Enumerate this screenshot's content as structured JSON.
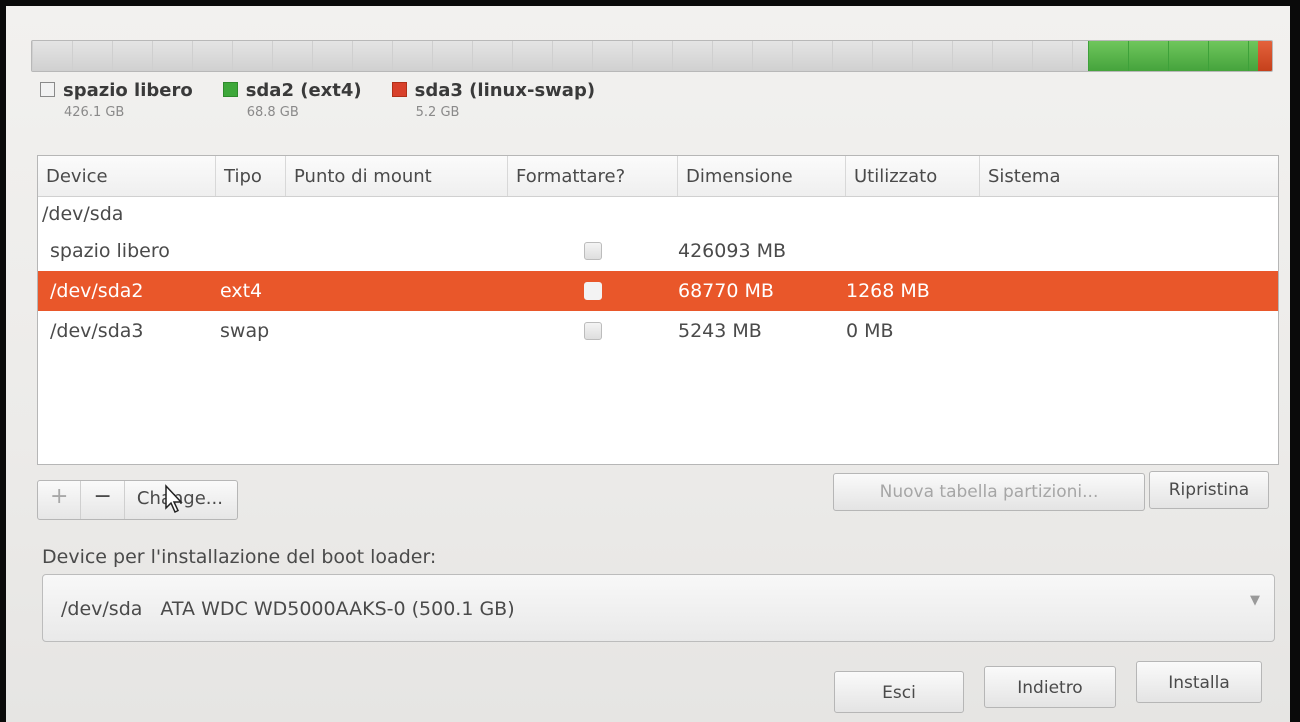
{
  "partition_bar": {
    "segments": [
      {
        "name": "spazio libero",
        "fraction": 0.852,
        "color": "#d7d7d7"
      },
      {
        "name": "sda2 (ext4)",
        "fraction": 0.137,
        "color": "#4caf43"
      },
      {
        "name": "sda3 (linux-swap)",
        "fraction": 0.011,
        "color": "#d24a24"
      }
    ]
  },
  "legend": [
    {
      "label": "spazio libero",
      "size": "426.1 GB",
      "color": "#f2f2f2"
    },
    {
      "label": "sda2 (ext4)",
      "size": "68.8 GB",
      "color": "#3ea83a"
    },
    {
      "label": "sda3 (linux-swap)",
      "size": "5.2 GB",
      "color": "#d8402a"
    }
  ],
  "table": {
    "columns": [
      "Device",
      "Tipo",
      "Punto di mount",
      "Formattare?",
      "Dimensione",
      "Utilizzato",
      "Sistema"
    ],
    "group": "/dev/sda",
    "rows": [
      {
        "device": "spazio libero",
        "tipo": "",
        "mount": "",
        "format": false,
        "size": "426093 MB",
        "used": "",
        "system": "",
        "selected": false
      },
      {
        "device": "/dev/sda2",
        "tipo": "ext4",
        "mount": "",
        "format": false,
        "size": "68770 MB",
        "used": "1268 MB",
        "system": "",
        "selected": true
      },
      {
        "device": "/dev/sda3",
        "tipo": "swap",
        "mount": "",
        "format": false,
        "size": "5243 MB",
        "used": "0 MB",
        "system": "",
        "selected": false
      }
    ]
  },
  "toolbar": {
    "add_label": "+",
    "remove_label": "−",
    "change_label": "Change...",
    "new_table_label": "Nuova tabella partizioni...",
    "revert_label": "Ripristina"
  },
  "bootloader": {
    "label": "Device per l'installazione del boot loader:",
    "device": "/dev/sda",
    "description": "ATA WDC WD5000AAKS-0 (500.1 GB)"
  },
  "actions": {
    "quit_label": "Esci",
    "back_label": "Indietro",
    "install_label": "Installa"
  }
}
